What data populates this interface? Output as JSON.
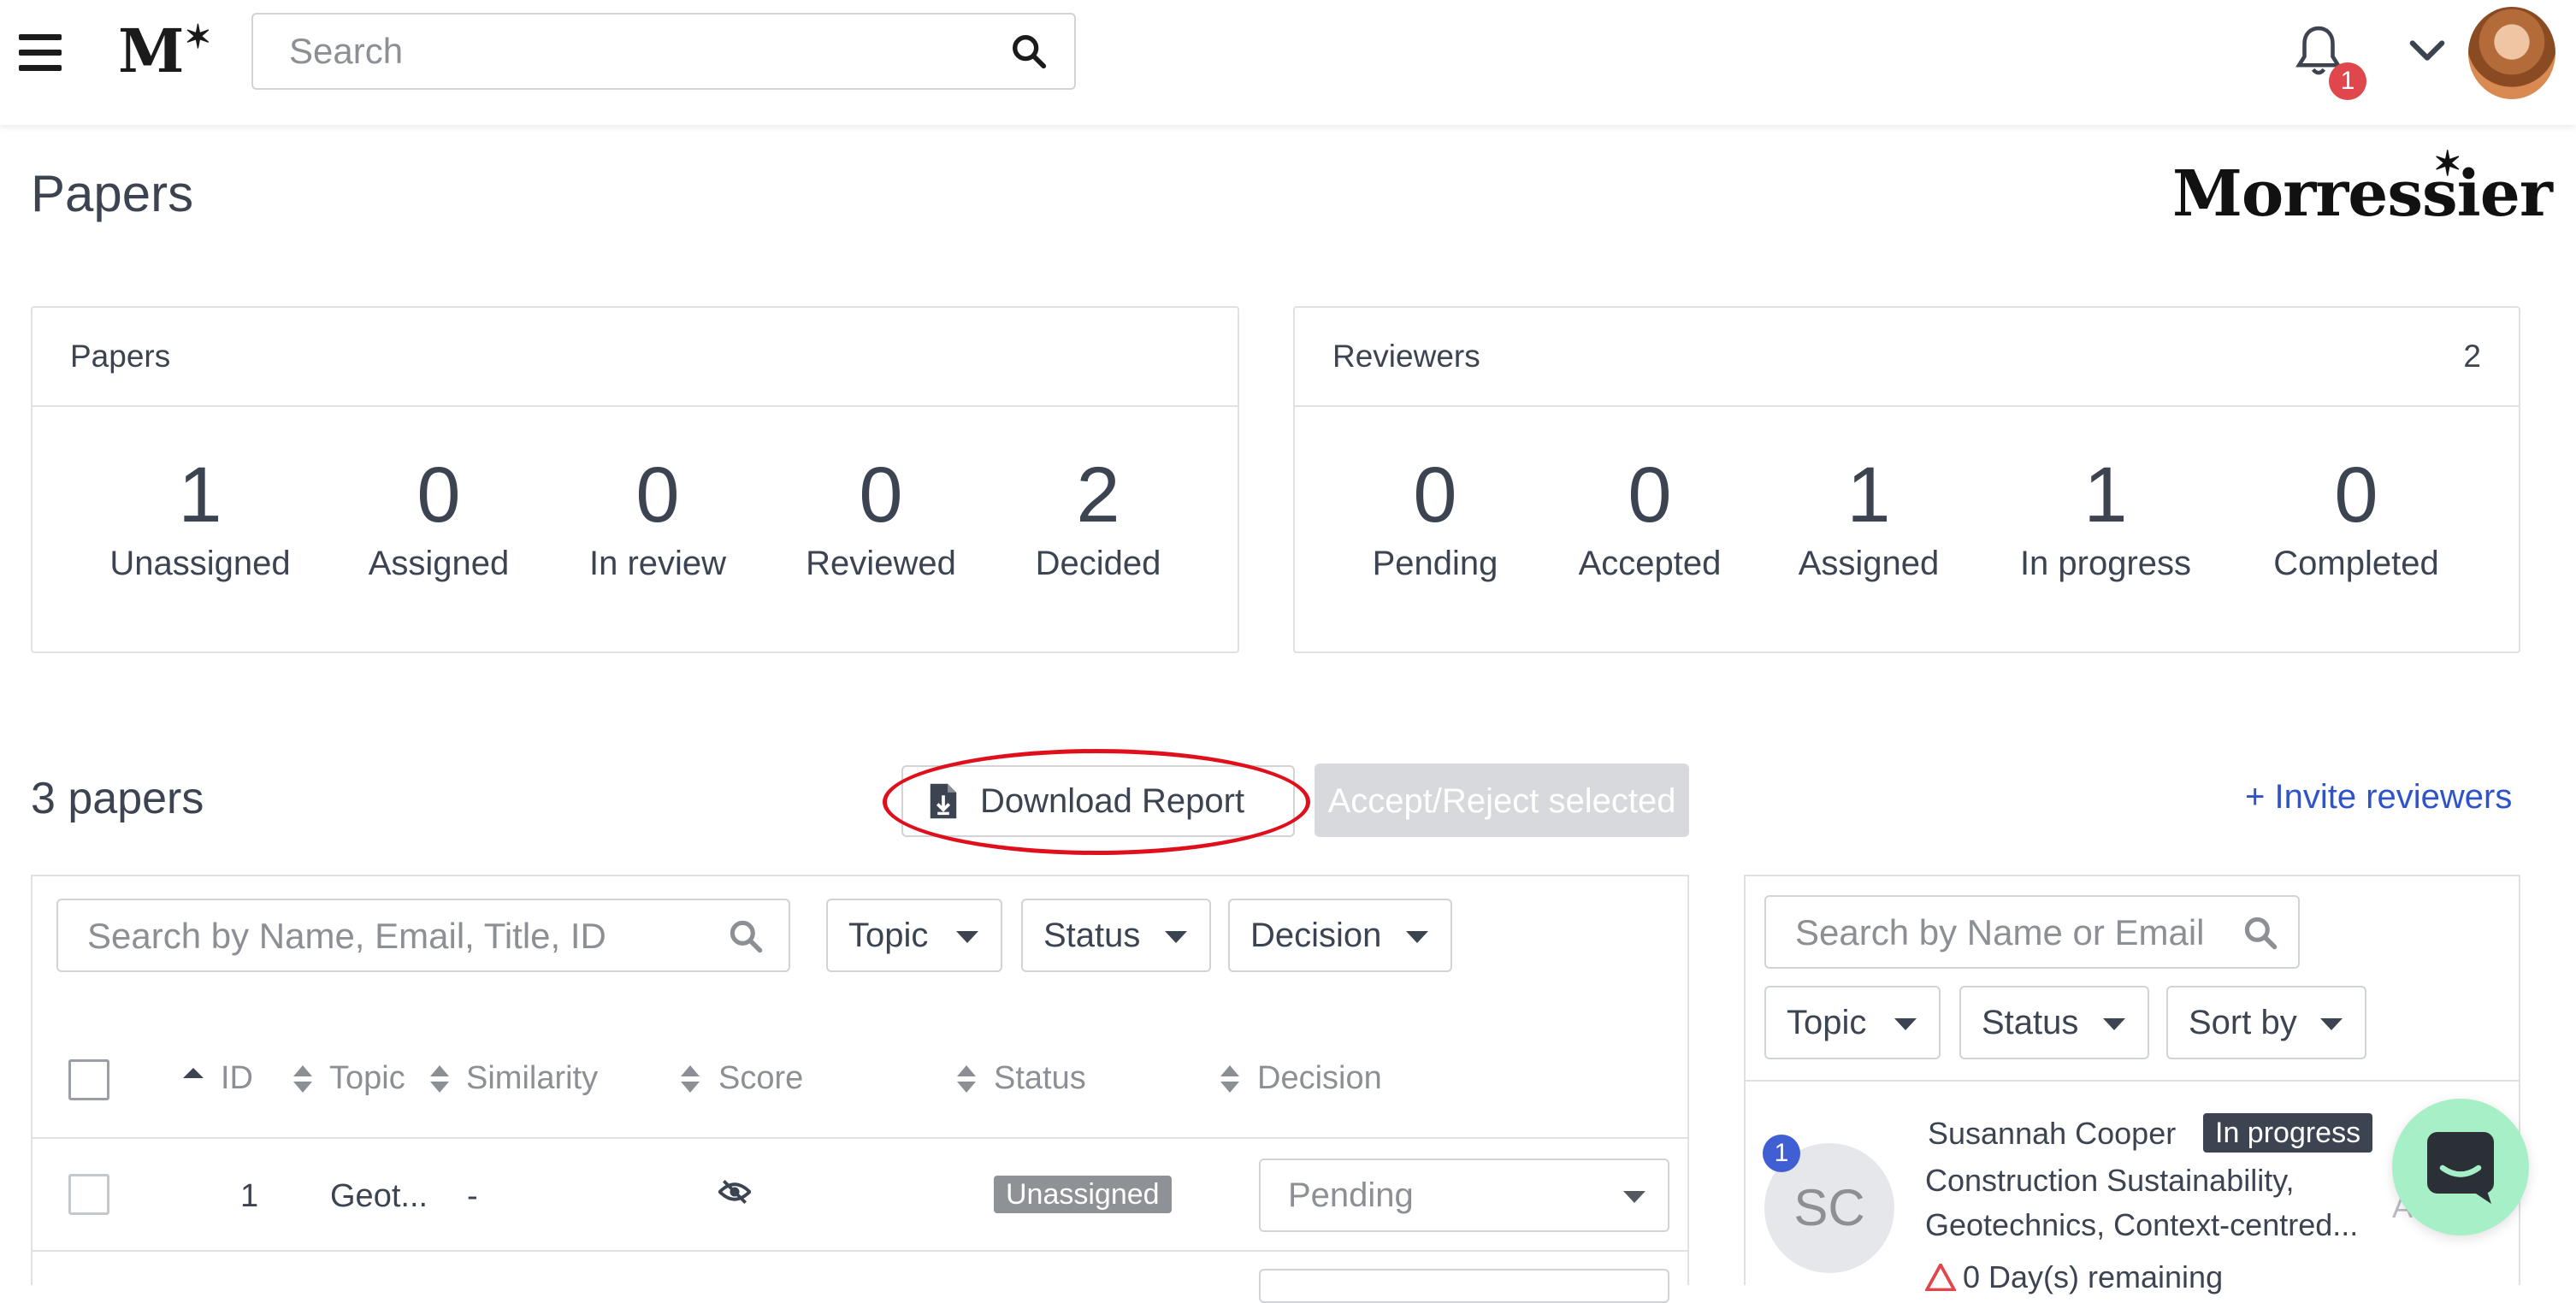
{
  "header": {
    "search_placeholder": "Search",
    "notification_count": "1",
    "icons": {
      "menu": "hamburger-icon",
      "search": "search-icon",
      "bell": "bell-icon",
      "account": "chevron-down-icon"
    }
  },
  "page": {
    "title": "Papers",
    "brand": "Morressier"
  },
  "papers_summary": {
    "title": "Papers",
    "stats": [
      {
        "value": "1",
        "label": "Unassigned"
      },
      {
        "value": "0",
        "label": "Assigned"
      },
      {
        "value": "0",
        "label": "In review"
      },
      {
        "value": "0",
        "label": "Reviewed"
      },
      {
        "value": "2",
        "label": "Decided"
      }
    ]
  },
  "reviewers_summary": {
    "title": "Reviewers",
    "count": "2",
    "stats": [
      {
        "value": "0",
        "label": "Pending"
      },
      {
        "value": "0",
        "label": "Accepted"
      },
      {
        "value": "1",
        "label": "Assigned"
      },
      {
        "value": "1",
        "label": "In progress"
      },
      {
        "value": "0",
        "label": "Completed"
      }
    ]
  },
  "toolbar": {
    "papers_count": "3 papers",
    "download_label": "Download Report",
    "accept_reject_label": "Accept/Reject selected",
    "invite_label": "+ Invite reviewers"
  },
  "papers_table": {
    "search_placeholder": "Search by Name, Email, Title, ID",
    "filters": [
      "Topic",
      "Status",
      "Decision"
    ],
    "columns": [
      "ID",
      "Topic",
      "Similarity",
      "Score",
      "Status",
      "Decision"
    ],
    "rows": [
      {
        "id": "1",
        "topic": "Geot...",
        "similarity": "-",
        "score": "hidden",
        "status": "Unassigned",
        "decision": "Pending"
      }
    ]
  },
  "reviewers_panel": {
    "search_placeholder": "Search by Name or Email",
    "filters": [
      "Topic",
      "Status",
      "Sort by"
    ],
    "items": [
      {
        "initials": "SC",
        "badge": "1",
        "name": "Susannah Cooper",
        "status": "In progress",
        "topics": "Construction Sustainability, Geotechnics, Context-centred...",
        "remaining": "0 Day(s) remaining",
        "truncated": "A"
      }
    ]
  },
  "colors": {
    "accent": "#2f53c9",
    "annotation": "#e00f1c",
    "chat": "#a7efc6",
    "badge": "#e0474c"
  }
}
